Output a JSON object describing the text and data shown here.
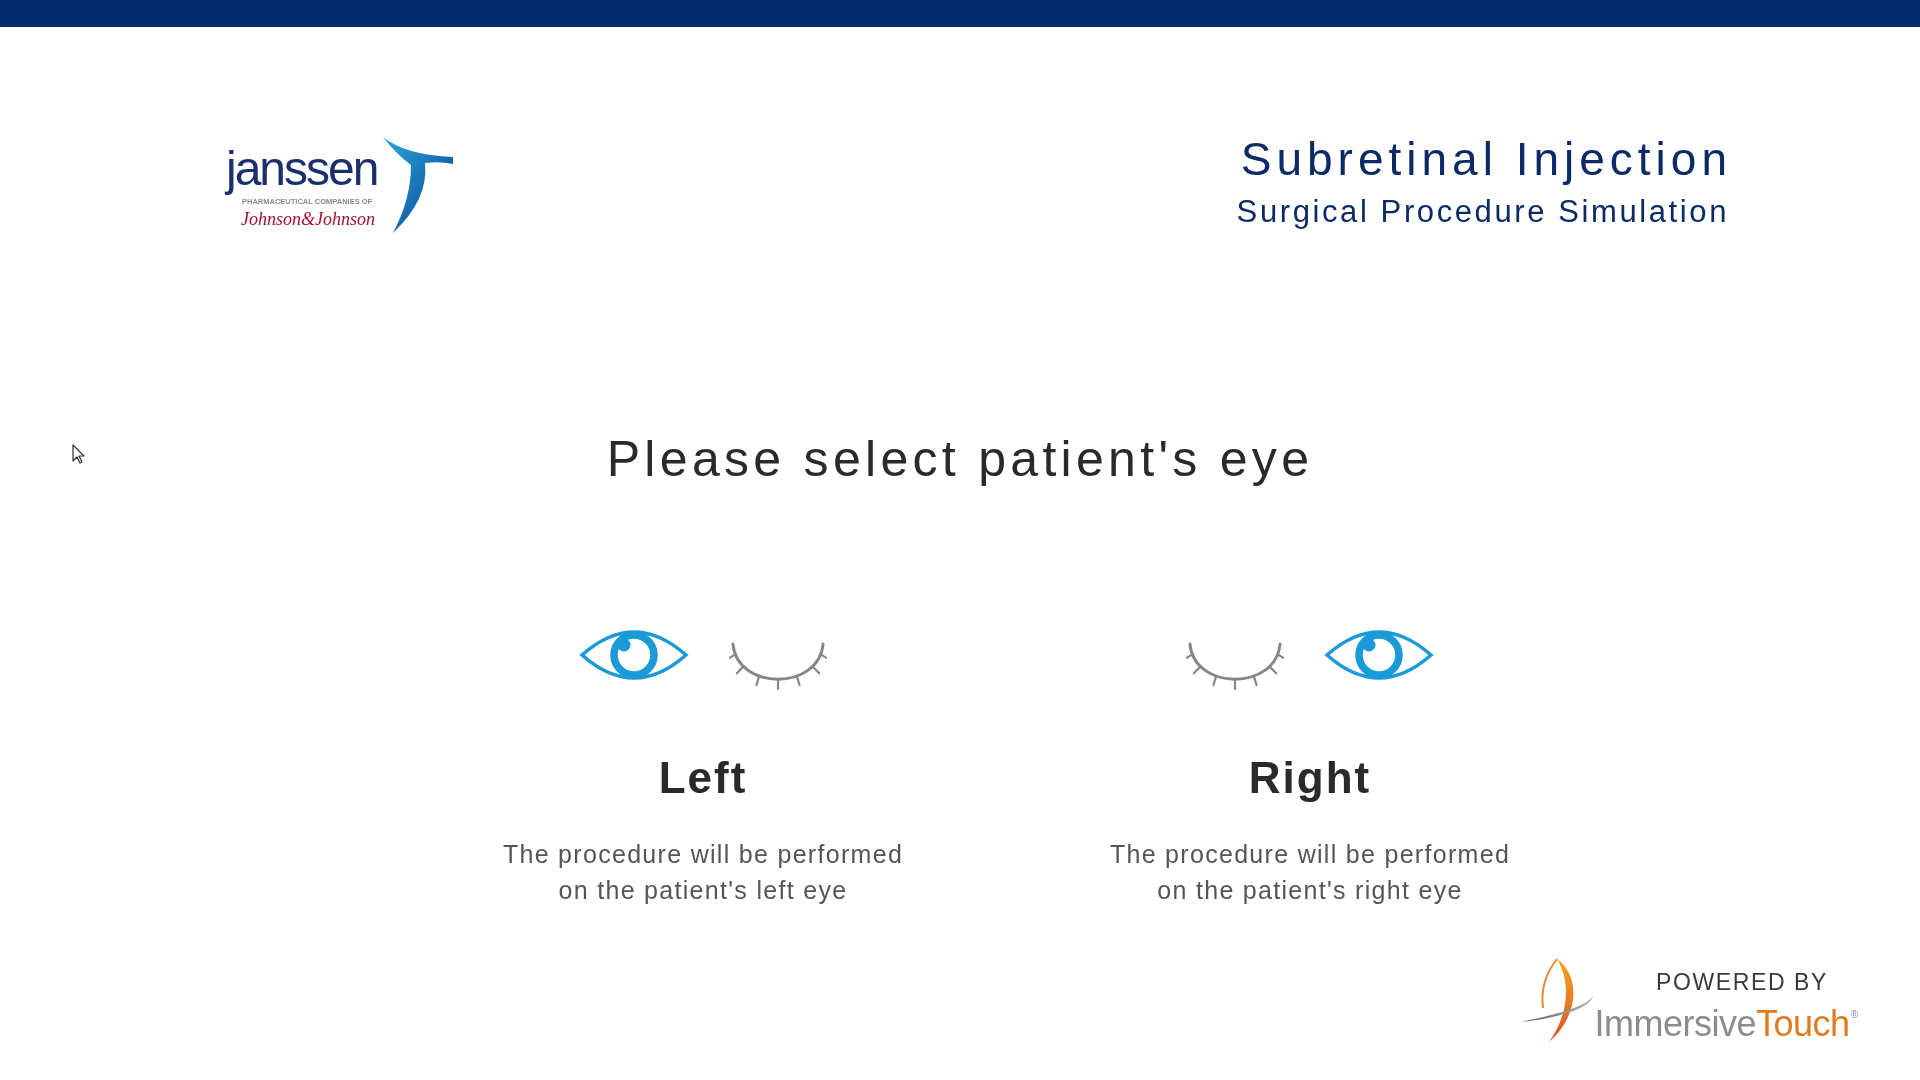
{
  "header": {
    "logo": {
      "wordmark": "janssen",
      "tagline": "PHARMACEUTICAL COMPANIES OF",
      "parent": "Johnson&Johnson"
    },
    "title": "Subretinal Injection",
    "subtitle": "Surgical Procedure Simulation"
  },
  "prompt": "Please select patient's eye",
  "options": [
    {
      "label": "Left",
      "description": [
        "The procedure will be performed",
        "on the patient's left eye"
      ],
      "eyes": [
        {
          "open": true
        },
        {
          "open": false
        }
      ]
    },
    {
      "label": "Right",
      "description": [
        "The procedure will be performed",
        "on the patient's right eye"
      ],
      "eyes": [
        {
          "open": false
        },
        {
          "open": true
        }
      ]
    }
  ],
  "footer": {
    "powered_by": "POWERED BY",
    "brand": [
      "Immersive",
      "Touch"
    ],
    "registered": "®"
  }
}
